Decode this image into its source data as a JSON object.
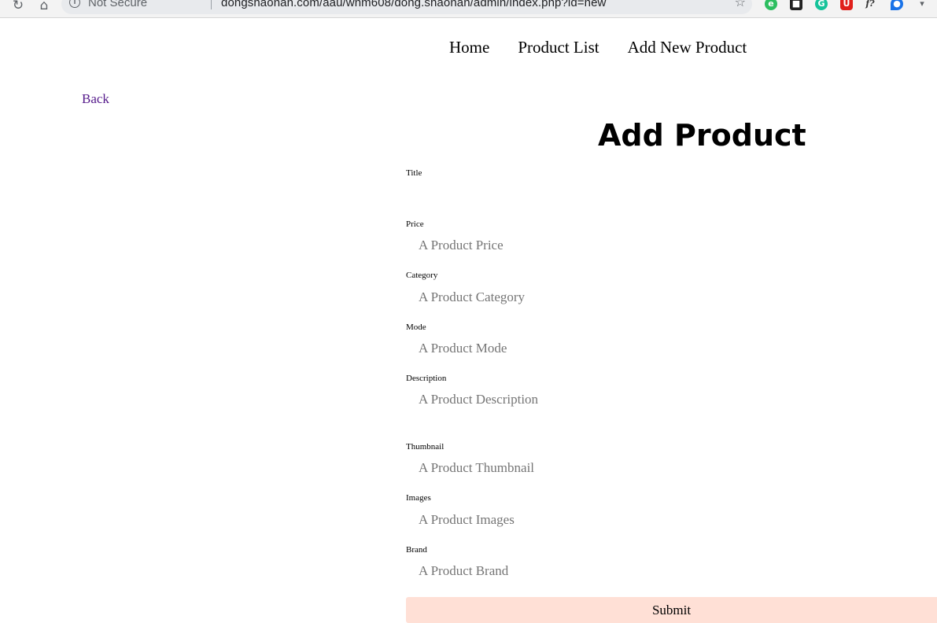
{
  "browser": {
    "security_label": "Not Secure",
    "url": "dongshaonan.com/aau/wnm608/dong.shaonan/admin/index.php?id=new"
  },
  "nav": {
    "items": [
      "Home",
      "Product List",
      "Add New Product"
    ]
  },
  "back_label": "Back",
  "form": {
    "title": "Add Product",
    "fields": [
      {
        "label": "Title",
        "placeholder": "",
        "value": ""
      },
      {
        "label": "Price",
        "placeholder": "A Product Price",
        "value": ""
      },
      {
        "label": "Category",
        "placeholder": "A Product Category",
        "value": ""
      },
      {
        "label": "Mode",
        "placeholder": "A Product Mode",
        "value": ""
      },
      {
        "label": "Description",
        "placeholder": "A Product Description",
        "value": ""
      },
      {
        "label": "Thumbnail",
        "placeholder": "A Product Thumbnail",
        "value": ""
      },
      {
        "label": "Images",
        "placeholder": "A Product Images",
        "value": ""
      },
      {
        "label": "Brand",
        "placeholder": "A Product Brand",
        "value": ""
      }
    ],
    "submit_label": "Submit"
  },
  "colors": {
    "link_visited": "#551a8b",
    "submit_bg": "#ffe0d6"
  }
}
